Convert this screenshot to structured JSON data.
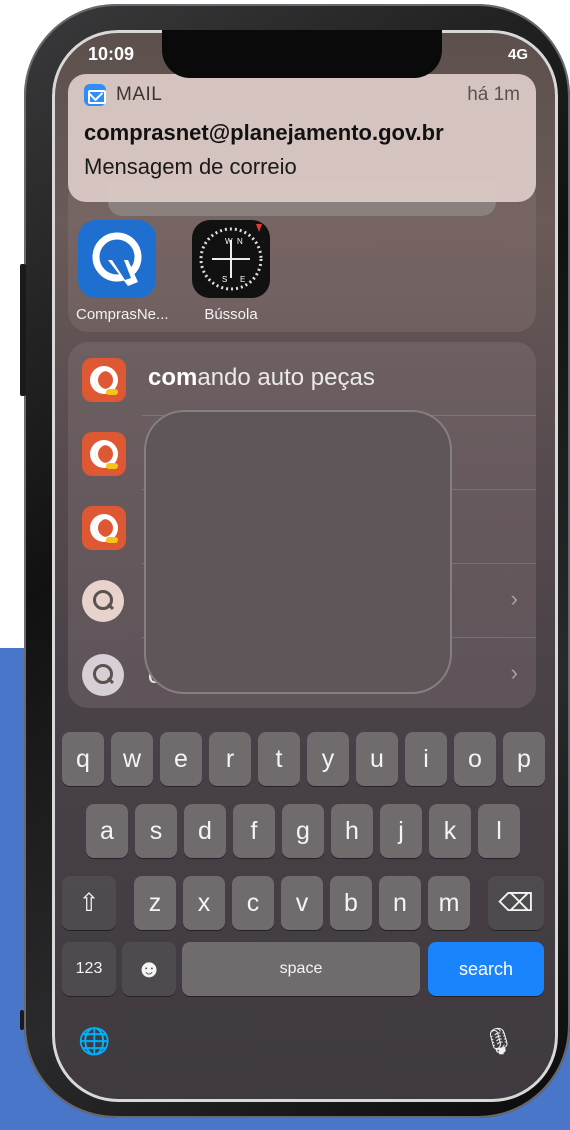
{
  "status": {
    "time": "10:09",
    "right": "4G"
  },
  "notification": {
    "app_name": "MAIL",
    "time": "há 1m",
    "sender": "comprasnet@planejamento.gov.br",
    "subject": "Mensagem de correio"
  },
  "apps": [
    {
      "name": "ComprasNe...",
      "icon": "comprasnet-app-icon"
    },
    {
      "name": "Bússola",
      "icon": "compass-app-icon"
    }
  ],
  "results": [
    {
      "icon": "duckduckgo-icon",
      "bold": "com",
      "rest": "ando auto peças"
    },
    {
      "icon": "duckduckgo-icon",
      "bold": "",
      "rest": ""
    },
    {
      "icon": "duckduckgo-icon",
      "bold": "",
      "rest": ""
    },
    {
      "icon": "search-icon",
      "bold": "",
      "rest": ""
    },
    {
      "icon": "search-icon",
      "bold": "",
      "rest": "c"
    }
  ],
  "keyboard": {
    "row1": [
      "q",
      "w",
      "e",
      "r",
      "t",
      "y",
      "u",
      "i",
      "o",
      "p"
    ],
    "row2": [
      "a",
      "s",
      "d",
      "f",
      "g",
      "h",
      "j",
      "k",
      "l"
    ],
    "row3": [
      "z",
      "x",
      "c",
      "v",
      "b",
      "n",
      "m"
    ],
    "numbers_label": "123",
    "space_label": "space",
    "search_label": "search",
    "shift_glyph": "⇧",
    "delete_glyph": "⌫",
    "emoji_glyph": "☻",
    "globe_glyph": "🌐",
    "mic_glyph": "🎙"
  },
  "colors": {
    "search_key": "#1a84ff",
    "background_block": "#4a76c9"
  }
}
